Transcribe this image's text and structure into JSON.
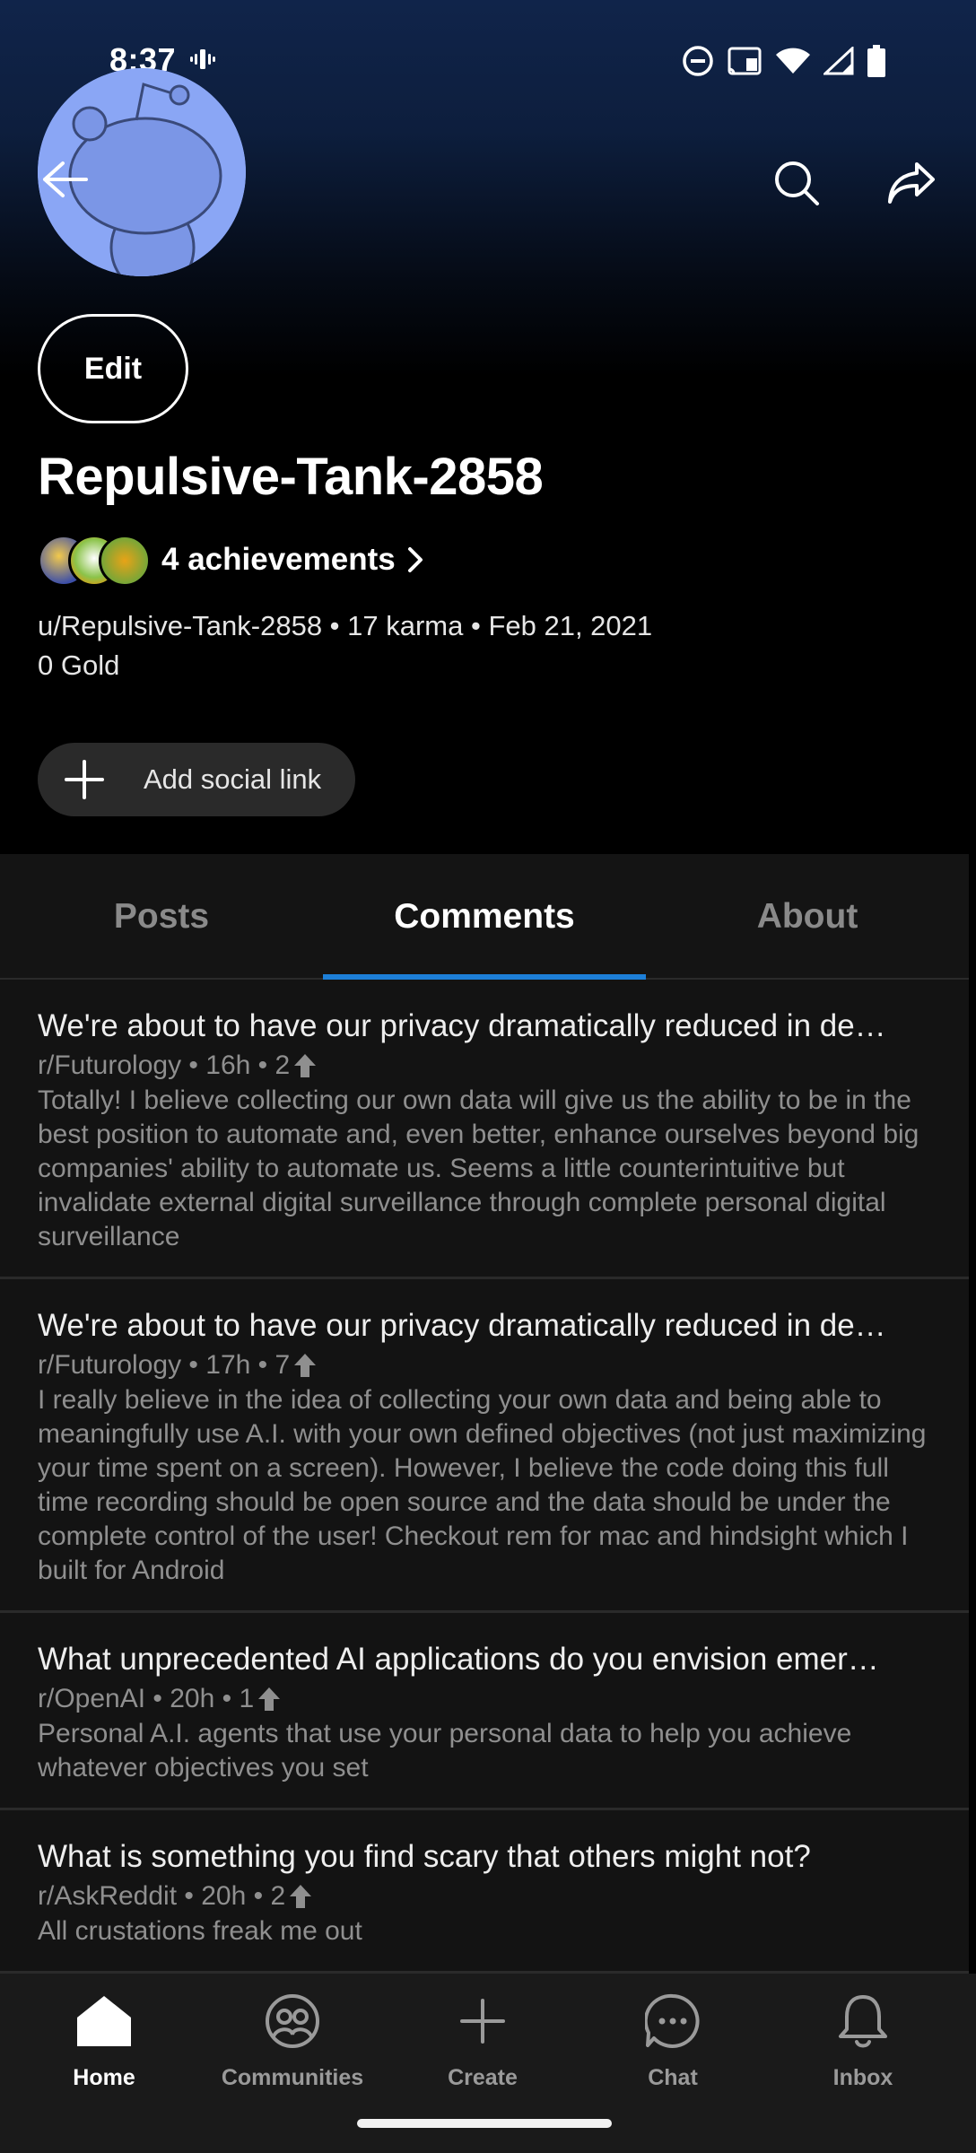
{
  "status_bar": {
    "time": "8:37",
    "icons": [
      "vibrate-icon",
      "dnd-icon",
      "cast-icon",
      "wifi-icon",
      "signal-icon",
      "battery-icon"
    ]
  },
  "header": {
    "gradient_top": "#10244a",
    "gradient_bottom": "#000000",
    "avatar_color": "#8aa6f5"
  },
  "profile": {
    "edit_label": "Edit",
    "username": "Repulsive-Tank-2858",
    "achievements_label": "4 achievements",
    "meta": "u/Repulsive-Tank-2858 • 17 karma • Feb 21, 2021",
    "gold": "0 Gold",
    "social_label": "Add social link"
  },
  "tabs": [
    {
      "label": "Posts",
      "active": false
    },
    {
      "label": "Comments",
      "active": true
    },
    {
      "label": "About",
      "active": false
    }
  ],
  "accent": "#1d7fd8",
  "comments": [
    {
      "title": "We're about to have our privacy dramatically reduced in de…",
      "subreddit": "r/Futurology",
      "time": "16h",
      "votes": "2",
      "body": "Totally! I believe collecting our own data will give us the ability to be in the best position to automate and, even better, enhance ourselves beyond big companies' ability to automate us. Seems a little counterintuitive but invalidate external digital surveillance through complete personal digital surveillance"
    },
    {
      "title": "We're about to have our privacy dramatically reduced in de…",
      "subreddit": "r/Futurology",
      "time": "17h",
      "votes": "7",
      "body": "I really believe in the idea of collecting your own data and being able to meaningfully use A.I. with your own defined objectives (not just maximizing your time spent on a screen). However, I believe the code doing this full time recording should be open source and the data should be under the complete control of the user!  Checkout rem for mac and hindsight which I built for Android"
    },
    {
      "title": "What unprecedented AI applications do you envision emer…",
      "subreddit": "r/OpenAI",
      "time": "20h",
      "votes": "1",
      "body": "Personal A.I. agents that use your personal data to help you achieve whatever objectives you set"
    },
    {
      "title": "What is something you find scary that others might not?",
      "subreddit": "r/AskReddit",
      "time": "20h",
      "votes": "2",
      "body": "All crustations freak me out"
    }
  ],
  "bottom_nav": [
    {
      "label": "Home",
      "icon": "home-icon",
      "active": true
    },
    {
      "label": "Communities",
      "icon": "communities-icon",
      "active": false
    },
    {
      "label": "Create",
      "icon": "plus-icon",
      "active": false
    },
    {
      "label": "Chat",
      "icon": "chat-icon",
      "active": false
    },
    {
      "label": "Inbox",
      "icon": "bell-icon",
      "active": false
    }
  ]
}
